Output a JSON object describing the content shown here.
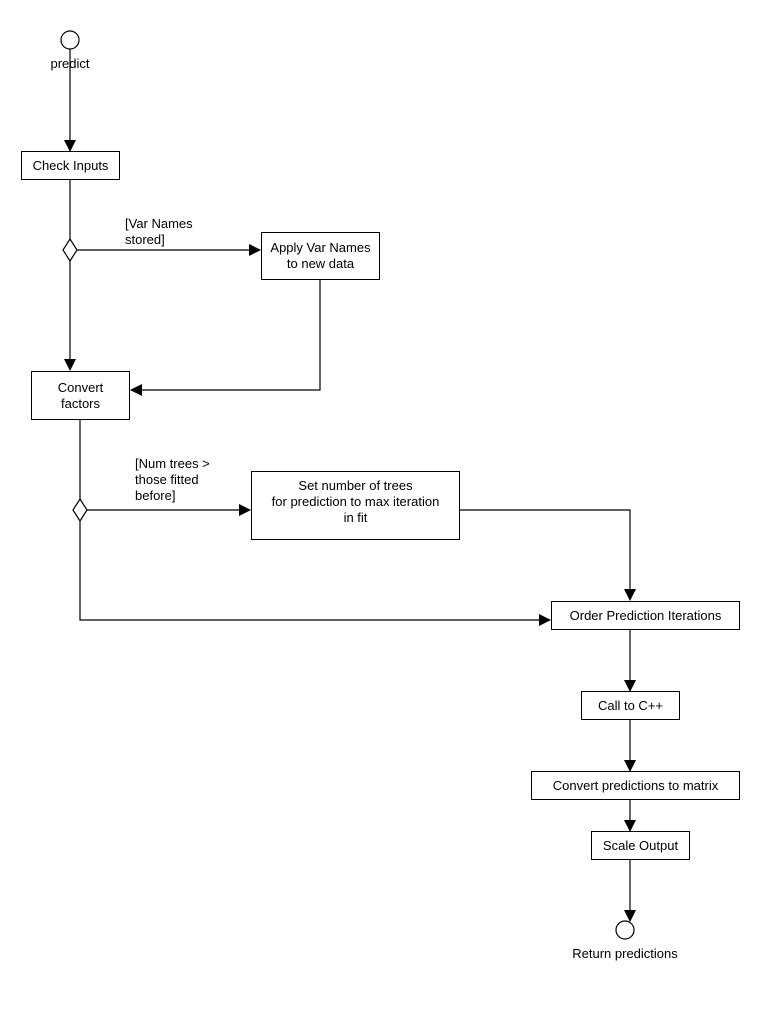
{
  "diagram": {
    "type": "UML activity diagram",
    "start": {
      "label": "predict"
    },
    "end": {
      "label": "Return predictions"
    },
    "actions": {
      "check_inputs": "Check Inputs",
      "apply_var_names": "Apply Var Names\nto new data",
      "convert_factors": "Convert\nfactors",
      "set_trees": "Set number of trees\nfor prediction to max iteration\nin fit",
      "order_iterations": "Order Prediction Iterations",
      "call_cpp": "Call to C++",
      "convert_matrix": "Convert predictions to matrix",
      "scale_output": "Scale Output"
    },
    "guards": {
      "var_names": "[Var Names\nstored]",
      "num_trees": "[Num trees >\nthose fitted\nbefore]"
    },
    "colors": {
      "line": "#000000",
      "background": "#ffffff"
    }
  }
}
